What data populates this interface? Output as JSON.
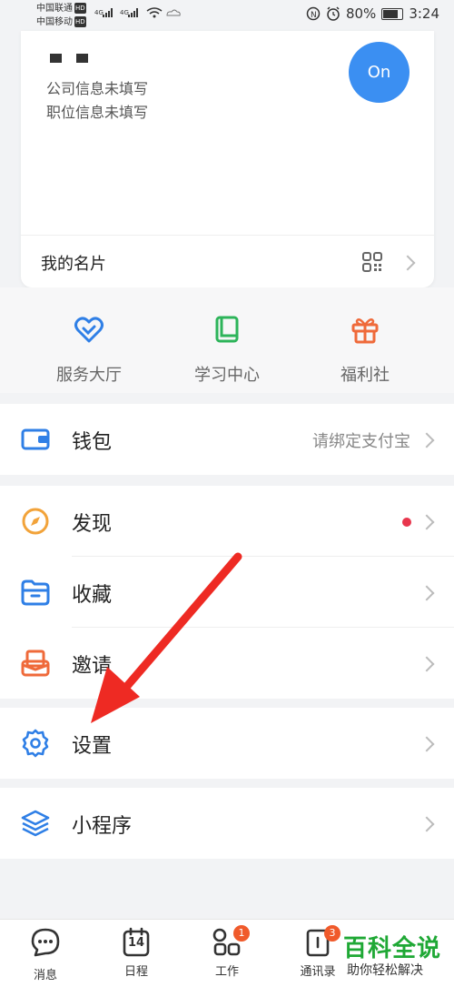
{
  "status_bar": {
    "carrier1": "中国联通",
    "carrier2": "中国移动",
    "hd": "HD",
    "battery": "80%",
    "time": "3:24"
  },
  "profile": {
    "company": "公司信息未填写",
    "position": "职位信息未填写",
    "status_button": "On",
    "card_label": "我的名片"
  },
  "quick_actions": [
    {
      "label": "服务大厅",
      "icon": "heart-service-icon",
      "color": "#2f7fe6"
    },
    {
      "label": "学习中心",
      "icon": "book-icon",
      "color": "#2db45a"
    },
    {
      "label": "福利社",
      "icon": "gift-icon",
      "color": "#ef6a3a"
    }
  ],
  "menu": {
    "wallet": {
      "label": "钱包",
      "sub": "请绑定支付宝"
    },
    "discover": {
      "label": "发现"
    },
    "favorites": {
      "label": "收藏"
    },
    "invite": {
      "label": "邀请"
    },
    "settings": {
      "label": "设置"
    },
    "mini_programs": {
      "label": "小程序"
    }
  },
  "tabs": [
    {
      "label": "消息",
      "icon": "chat-icon"
    },
    {
      "label": "日程",
      "icon": "calendar-icon",
      "date": "14"
    },
    {
      "label": "工作",
      "icon": "apps-grid-icon",
      "badge": "1"
    },
    {
      "label": "通讯录",
      "icon": "contacts-icon",
      "badge": "3"
    }
  ],
  "watermark": {
    "main": "百科全说",
    "sub": "助你轻松解决"
  },
  "colors": {
    "accent": "#3b8ff2",
    "red_dot": "#e8364d",
    "arrow": "#ee2a23",
    "badge": "#f05a2b"
  }
}
